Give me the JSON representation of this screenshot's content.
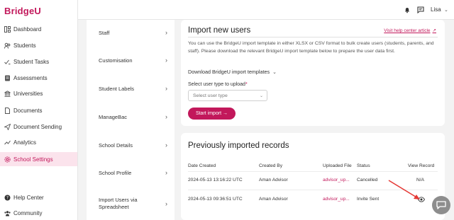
{
  "brand": {
    "logo_text": "BridgeU",
    "accent_color": "#c2185b"
  },
  "nav": {
    "items": [
      {
        "label": "Dashboard",
        "icon": "dashboard-icon"
      },
      {
        "label": "Students",
        "icon": "students-icon"
      },
      {
        "label": "Student Tasks",
        "icon": "tasks-icon"
      },
      {
        "label": "Assessments",
        "icon": "assessments-icon"
      },
      {
        "label": "Universities",
        "icon": "universities-icon"
      },
      {
        "label": "Documents",
        "icon": "documents-icon"
      },
      {
        "label": "Document Sending",
        "icon": "send-icon"
      },
      {
        "label": "Analytics",
        "icon": "analytics-icon"
      },
      {
        "label": "School Settings",
        "icon": "settings-icon",
        "active": true
      }
    ],
    "bottom": [
      {
        "label": "Help Center",
        "icon": "help-icon"
      },
      {
        "label": "Community",
        "icon": "community-icon"
      }
    ]
  },
  "topbar": {
    "user_name": "Lisa",
    "bell_icon": "bell-icon",
    "chat_icon": "chat-icon"
  },
  "submenu": {
    "items": [
      "Staff",
      "Customisation",
      "Student Labels",
      "ManageBac",
      "School Details",
      "School Profile",
      "Import Users via Spreadsheet"
    ]
  },
  "import": {
    "title": "Import new users",
    "help_link": "Visit help center article",
    "description": "You can use the BridgeU import template in either XLSX or CSV format to bulk create users (students, parents, and staff). Please download the relevant BridgeU import template below to prepare the user data first.",
    "download_label": "Download BridgeU import templates",
    "select_label": "Select user type to upload",
    "select_required_mark": "*",
    "select_placeholder": "Select user type",
    "start_button": "Start import →"
  },
  "records": {
    "title": "Previously imported records",
    "columns": [
      "Date Created",
      "Created By",
      "Uploaded File",
      "Status",
      "View Record"
    ],
    "rows": [
      {
        "date": "2024-05-13 13:16:22 UTC",
        "created_by": "Aman Advisor",
        "file": "advisor_up...",
        "status": "Cancelled",
        "view": "N/A"
      },
      {
        "date": "2024-05-13 09:36:51 UTC",
        "created_by": "Aman Advisor",
        "file": "advisor_up...",
        "status": "Invite Sent",
        "view": "eye-icon"
      }
    ]
  }
}
